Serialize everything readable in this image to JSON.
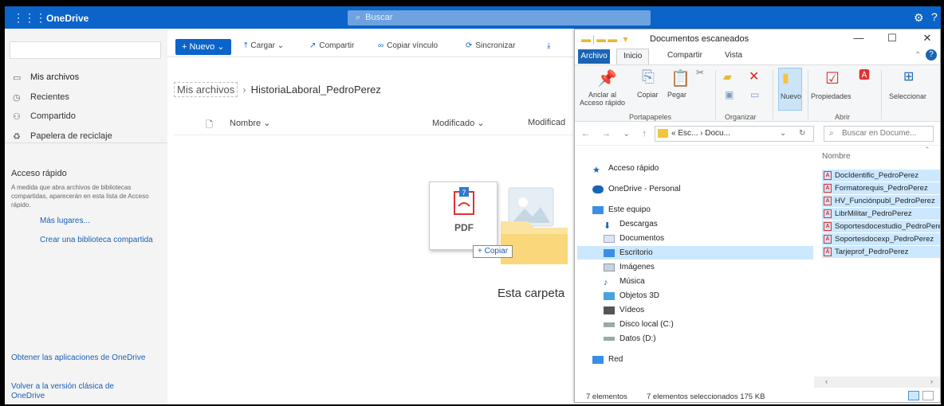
{
  "onedrive": {
    "brand": "OneDrive",
    "search_placeholder": "Buscar",
    "nav": {
      "items": [
        {
          "label": "Mis archivos",
          "icon": "folder-icon"
        },
        {
          "label": "Recientes",
          "icon": "clock-icon"
        },
        {
          "label": "Compartido",
          "icon": "people-icon"
        },
        {
          "label": "Papelera de reciclaje",
          "icon": "recycle-bin-icon"
        }
      ],
      "quick_access_title": "Acceso rápido",
      "quick_access_desc": "A medida que abra archivos de bibliotecas compartidas, aparecerán en esta lista de Acceso rápido.",
      "more_places": "Más lugares...",
      "create_library": "Crear una biblioteca compartida",
      "get_apps": "Obtener las aplicaciones de OneDrive",
      "classic": "Volver a la versión clásica de OneDrive"
    },
    "toolbar": {
      "new_label": "+ Nuevo",
      "upload": "Cargar",
      "share": "Compartir",
      "copy_link": "Copiar vínculo",
      "sync": "Sincronizar"
    },
    "breadcrumb": {
      "root": "Mis archivos",
      "current": "HistoriaLaboral_PedroPerez"
    },
    "columns": {
      "name": "Nombre",
      "modified": "Modificado",
      "modified_by": "Modificad"
    },
    "drag": {
      "file_type": "PDF",
      "tooltip": "+ Copiar"
    },
    "empty_text": "Esta carpeta"
  },
  "explorer": {
    "title": "Documentos escaneados",
    "tabs": [
      "Archivo",
      "Inicio",
      "Compartir",
      "Vista"
    ],
    "ribbon": {
      "pin": "Anclar al\nAcceso rápido",
      "copy": "Copiar",
      "paste": "Pegar",
      "group_clipboard": "Portapapeles",
      "group_organize": "Organizar",
      "new": "Nuevo",
      "properties": "Propiedades",
      "group_open": "Abrir",
      "select": "Seleccionar"
    },
    "address": {
      "path": "« Esc... › Docu...",
      "search_placeholder": "Buscar en Docume..."
    },
    "tree": [
      {
        "label": "Acceso rápido",
        "icon": "star-icon"
      },
      {
        "label": "OneDrive - Personal",
        "icon": "cloud-icon"
      },
      {
        "label": "Este equipo",
        "icon": "computer-icon"
      },
      {
        "label": "Descargas",
        "icon": "download-icon"
      },
      {
        "label": "Documentos",
        "icon": "document-icon"
      },
      {
        "label": "Escritorio",
        "icon": "desktop-icon"
      },
      {
        "label": "Imágenes",
        "icon": "pictures-icon"
      },
      {
        "label": "Música",
        "icon": "music-icon"
      },
      {
        "label": "Objetos 3D",
        "icon": "cube-icon"
      },
      {
        "label": "Vídeos",
        "icon": "video-icon"
      },
      {
        "label": "Disco local (C:)",
        "icon": "drive-icon"
      },
      {
        "label": "Datos (D:)",
        "icon": "drive-icon"
      },
      {
        "label": "Red",
        "icon": "network-icon"
      }
    ],
    "files_header": "Nombre",
    "files": [
      "DocIdentific_PedroPerez",
      "Formatorequis_PedroPerez",
      "HV_Funciónpubl_PedroPerez",
      "LibrMilitar_PedroPerez",
      "Soportesdocestudio_PedroPerez",
      "Soportesdocexp_PedroPerez",
      "Tarjeprof_PedroPerez"
    ],
    "status": {
      "count": "7 elementos",
      "selected": "7 elementos seleccionados  175 KB"
    }
  }
}
